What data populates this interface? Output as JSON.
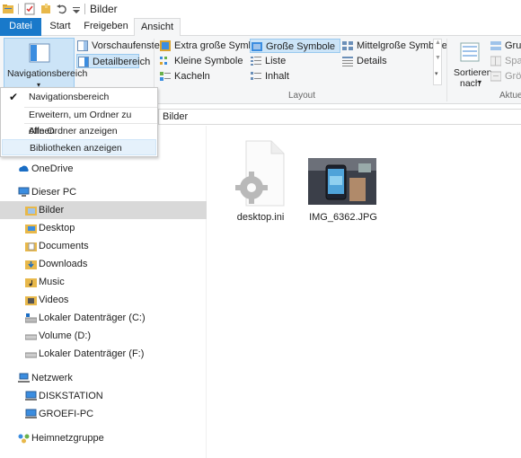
{
  "window": {
    "title": "Bilder"
  },
  "tabs": [
    {
      "label": "Datei"
    },
    {
      "label": "Start"
    },
    {
      "label": "Freigeben"
    },
    {
      "label": "Ansicht"
    }
  ],
  "ribbon": {
    "navigationsbereich_label": "Navigationsbereich",
    "vorschaufenster_label": "Vorschaufenster",
    "detailbereich_label": "Detailbereich",
    "layout_items": [
      {
        "label": "Extra große Symbole"
      },
      {
        "label": "Große Symbole"
      },
      {
        "label": "Mittelgroße Symbole"
      },
      {
        "label": "Kleine Symbole"
      },
      {
        "label": "Liste"
      },
      {
        "label": "Details"
      },
      {
        "label": "Kacheln"
      },
      {
        "label": "Inhalt"
      }
    ],
    "layout_group_label": "Layout",
    "sortieren_label": "Sortieren",
    "sortieren_nach_label": "nach",
    "aktuell_group_label": "Aktue",
    "gruppieren_label": "Grup",
    "spalten_label": "Spalt",
    "groesse_label": "Größ"
  },
  "menu": {
    "items": [
      {
        "label": "Navigationsbereich",
        "checked": true
      },
      {
        "label": "Erweitern, um Ordner zu öffnen"
      },
      {
        "label": "Alle Ordner anzeigen"
      },
      {
        "label": "Bibliotheken anzeigen"
      }
    ]
  },
  "address": {
    "path": "Bilder"
  },
  "nav": {
    "items": [
      {
        "label": "OneDrive"
      },
      {
        "label": "Dieser PC"
      },
      {
        "label": "Bilder"
      },
      {
        "label": "Desktop"
      },
      {
        "label": "Documents"
      },
      {
        "label": "Downloads"
      },
      {
        "label": "Music"
      },
      {
        "label": "Videos"
      },
      {
        "label": "Lokaler Datenträger (C:)"
      },
      {
        "label": "Volume (D:)"
      },
      {
        "label": "Lokaler Datenträger (F:)"
      },
      {
        "label": "Netzwerk"
      },
      {
        "label": "DISKSTATION"
      },
      {
        "label": "GROEFI-PC"
      },
      {
        "label": "Heimnetzgruppe"
      }
    ]
  },
  "files": [
    {
      "name": "desktop.ini"
    },
    {
      "name": "IMG_6362.JPG"
    }
  ],
  "colors": {
    "accent": "#1979ca",
    "selection": "#cce4f7",
    "folder": "#e8b84a"
  }
}
